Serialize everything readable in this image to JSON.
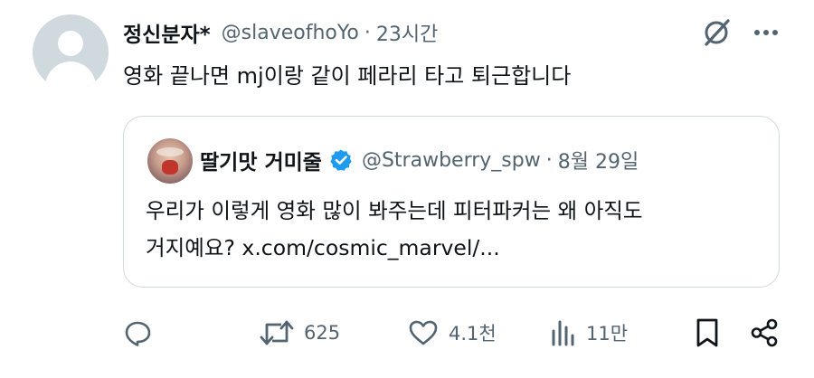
{
  "tweet": {
    "author_name": "정신분자*",
    "handle": "@slaveofhoYo",
    "separator": "·",
    "time": "23시간",
    "text": "영화 끝나면 mj이랑 같이 페라리 타고 퇴근합니다"
  },
  "quoted_tweet": {
    "author_name": "딸기맛 거미줄",
    "handle": "@Strawberry_spw",
    "separator": "·",
    "date": "8월 29일",
    "text_line1": "우리가 이렇게 영화 많이 봐주는데 피터파커는 왜 아직도",
    "text_line2": "거지예요? x.com/cosmic_marvel/..."
  },
  "actions": {
    "retweet_count": "625",
    "like_count": "4.1천",
    "views_count": "11만"
  },
  "icons": [
    "grok-icon",
    "more-icon",
    "verified-icon",
    "reply-icon",
    "retweet-icon",
    "like-icon",
    "views-icon",
    "bookmark-icon",
    "share-icon"
  ],
  "colors": {
    "text": "#0f1419",
    "muted": "#536471",
    "border": "#cfd9de",
    "verified": "#1d9bf0"
  }
}
